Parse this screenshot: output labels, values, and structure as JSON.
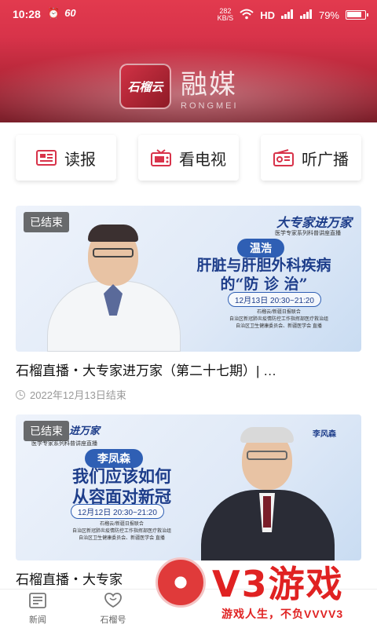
{
  "status_bar": {
    "time": "10:28",
    "net_speed_value": "282",
    "net_speed_unit": "KB/S",
    "network": "HD",
    "battery": "79%"
  },
  "brand": {
    "logo_text": "石榴云",
    "title": "融媒",
    "subtitle": "RONGMEI"
  },
  "nav": [
    {
      "label": "读报",
      "icon": "newspaper-icon"
    },
    {
      "label": "看电视",
      "icon": "tv-icon"
    },
    {
      "label": "听广播",
      "icon": "radio-icon"
    }
  ],
  "news": [
    {
      "badge": "已结束",
      "program": "大专家进万家",
      "program_sub": "医学专家系列科普讲座直播",
      "speaker": "温浩",
      "headline_line1": "肝脏与肝胆外科疾病",
      "headline_line2": "的“防 诊 治”",
      "time": "12月13日 20:30~21:20",
      "org": "石榴云/新疆日报联合\n自治区新冠肺炎疫情防控工作指挥部医疗救治组\n自治区卫生健康委员会、新疆医学会 直播",
      "title": "石榴直播・大专家进万家（第二十七期）| …",
      "meta": "2022年12月13日结束"
    },
    {
      "badge": "已结束",
      "program": "进万家",
      "program_sub": "医学专家系列科普讲座直播",
      "speaker": "李凤森",
      "headline_line1": "我们应该如何",
      "headline_line2": "从容面对新冠",
      "time": "12月12日 20:30~21:20",
      "org": "石榴云/新疆日报联合\n自治区新冠肺炎疫情防控工作指挥部医疗救治组\n自治区卫生健康委员会、新疆医学会 直播",
      "side_name": "李风森",
      "title": "石榴直播・大专家"
    }
  ],
  "tabs": [
    {
      "label": "新闻",
      "icon": "news-icon"
    },
    {
      "label": "石榴号",
      "icon": "pomegranate-icon"
    }
  ],
  "watermark": {
    "brand": "V3游戏",
    "slogan": "游戏人生，不负VVVV3"
  }
}
